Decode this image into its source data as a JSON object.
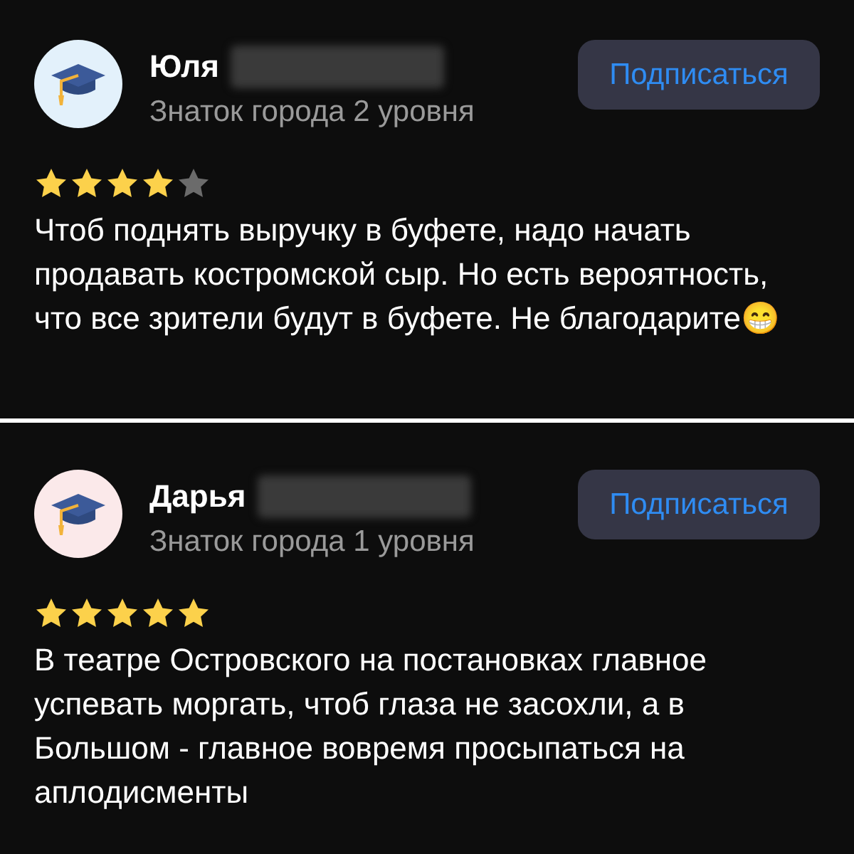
{
  "reviews": [
    {
      "author": "Юля",
      "color": "#e3f1fb",
      "level": "Знаток города 2 уровня",
      "subscribe": "Подписаться",
      "stars": 4,
      "text": "Чтоб поднять выручку в буфете, надо начать продавать костромской сыр. Но есть вероятность, что все зрители будут в буфете. Не благодарите😁"
    },
    {
      "author": "Дарья",
      "color": "#fbe9ea",
      "level": "Знаток города 1 уровня",
      "subscribe": "Подписаться",
      "stars": 5,
      "text": "В театре Островского на постановках главное успевать моргать, чтоб глаза не засохли, а в Большом - главное вовремя просыпаться на аплодисменты"
    }
  ]
}
